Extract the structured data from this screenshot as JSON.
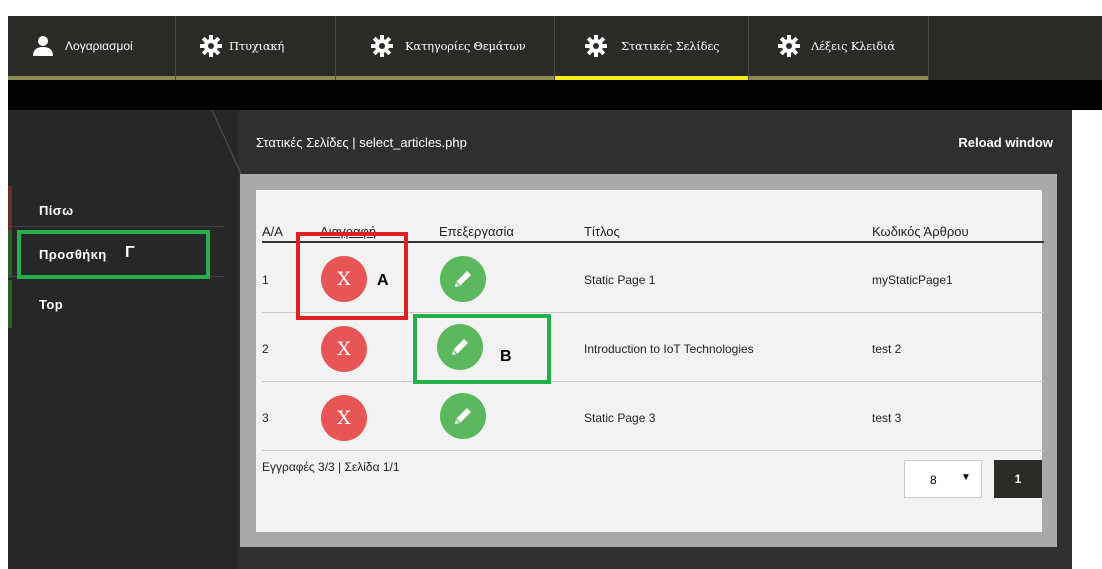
{
  "nav": {
    "tabs": [
      {
        "label": "Λογαριασμοί",
        "icon": "user-icon",
        "active": false
      },
      {
        "label": "Πτυχιακή",
        "icon": "gear-icon",
        "active": false
      },
      {
        "label": "Κατηγορίες Θεμάτων",
        "icon": "gear-icon",
        "active": false
      },
      {
        "label": "Στατικές Σελίδες",
        "icon": "gear-icon",
        "active": true
      },
      {
        "label": "Λέξεις Κλειδιά",
        "icon": "gear-icon",
        "active": false
      }
    ]
  },
  "sidebar": {
    "items": [
      {
        "label": "Πίσω"
      },
      {
        "label": "Προσθήκη"
      },
      {
        "label": "Top"
      }
    ]
  },
  "header": {
    "title": "Στατικές Σελίδες | select_articles.php",
    "reload": "Reload window"
  },
  "table": {
    "columns": [
      "A/A",
      "Διαγραφή",
      "Επεξεργασία",
      "Τίτλος",
      "Κωδικός Άρθρου"
    ],
    "rows": [
      {
        "aa": "1",
        "delete": "X",
        "title": "Static Page 1",
        "code": "myStaticPage1"
      },
      {
        "aa": "2",
        "delete": "X",
        "title": "Introduction to IoT Technologies",
        "code": "test 2"
      },
      {
        "aa": "3",
        "delete": "X",
        "title": "Static Page 3",
        "code": "test 3"
      }
    ]
  },
  "footer": {
    "info": "Εγγραφές 3/3 | Σελίδα 1/1",
    "page_size": "8",
    "page_size_arrow": "▼",
    "page": "1"
  },
  "annotations": {
    "a": "A",
    "b": "B",
    "g": "Γ"
  },
  "colors": {
    "nav_bg": "#2b2b28",
    "active_underline": "#f3ee14",
    "delete": "#e85555",
    "edit": "#5cb85c",
    "highlight_red": "#e02020",
    "highlight_green": "#23b04a"
  }
}
